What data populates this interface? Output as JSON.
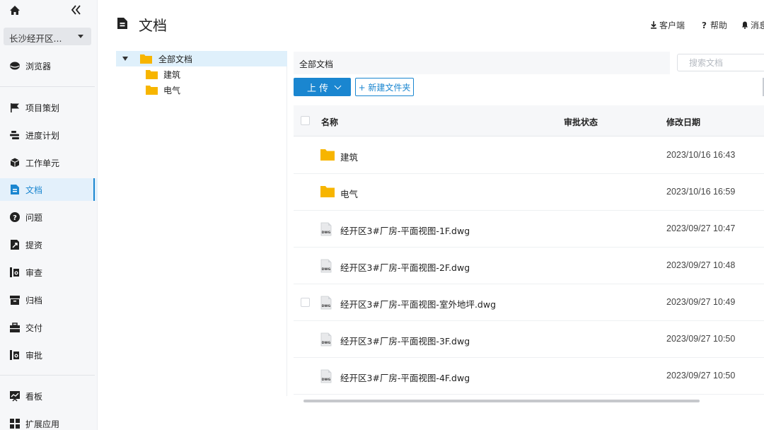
{
  "sidebar": {
    "project": "长沙经开区...",
    "items": [
      {
        "key": "browser",
        "label": "浏览器",
        "icon": "cube-sphere-icon"
      },
      {
        "key": "planning",
        "label": "项目策划",
        "icon": "flag-icon"
      },
      {
        "key": "schedule",
        "label": "进度计划",
        "icon": "gantt-icon"
      },
      {
        "key": "work-unit",
        "label": "工作单元",
        "icon": "box-icon"
      },
      {
        "key": "docs",
        "label": "文档",
        "icon": "document-icon",
        "active": true
      },
      {
        "key": "issues",
        "label": "问题",
        "icon": "question-icon"
      },
      {
        "key": "submit",
        "label": "提资",
        "icon": "submit-icon"
      },
      {
        "key": "review",
        "label": "审查",
        "icon": "review-icon"
      },
      {
        "key": "archive",
        "label": "归档",
        "icon": "archive-icon"
      },
      {
        "key": "deliver",
        "label": "交付",
        "icon": "briefcase-icon"
      },
      {
        "key": "approval",
        "label": "审批",
        "icon": "approval-icon"
      },
      {
        "key": "dashboard",
        "label": "看板",
        "icon": "chart-board-icon"
      },
      {
        "key": "extensions",
        "label": "扩展应用",
        "icon": "apps-grid-icon"
      }
    ]
  },
  "header": {
    "title": "文档",
    "links": [
      {
        "label": "客户端",
        "icon": "download-icon"
      },
      {
        "label": "帮助",
        "icon": "help-icon"
      },
      {
        "label": "消息",
        "icon": "bell-icon"
      }
    ]
  },
  "tree": {
    "root": "全部文档",
    "children": [
      "建筑",
      "电气"
    ]
  },
  "toolbar": {
    "path": "全部文档",
    "search_placeholder": "搜索文档",
    "upload_label": "上 传",
    "new_folder_label": "+ 新建文件夹"
  },
  "table": {
    "columns": {
      "name": "名称",
      "status": "审批状态",
      "date": "修改日期"
    },
    "rows": [
      {
        "type": "folder",
        "name": "建筑",
        "status": "",
        "date": "2023/10/16 16:43"
      },
      {
        "type": "folder",
        "name": "电气",
        "status": "",
        "date": "2023/10/16 16:59"
      },
      {
        "type": "dwg",
        "name": "经开区3#厂房-平面视图-1F.dwg",
        "status": "",
        "date": "2023/09/27 10:47"
      },
      {
        "type": "dwg",
        "name": "经开区3#厂房-平面视图-2F.dwg",
        "status": "",
        "date": "2023/09/27 10:48"
      },
      {
        "type": "dwg",
        "name": "经开区3#厂房-平面视图-室外地坪.dwg",
        "status": "",
        "date": "2023/09/27 10:49"
      },
      {
        "type": "dwg",
        "name": "经开区3#厂房-平面视图-3F.dwg",
        "status": "",
        "date": "2023/09/27 10:50"
      },
      {
        "type": "dwg",
        "name": "经开区3#厂房-平面视图-4F.dwg",
        "status": "",
        "date": "2023/09/27 10:50"
      }
    ]
  },
  "colors": {
    "accent": "#1a86d0",
    "folder": "#f7b500",
    "sidebar_bg": "#f6f7f9"
  }
}
